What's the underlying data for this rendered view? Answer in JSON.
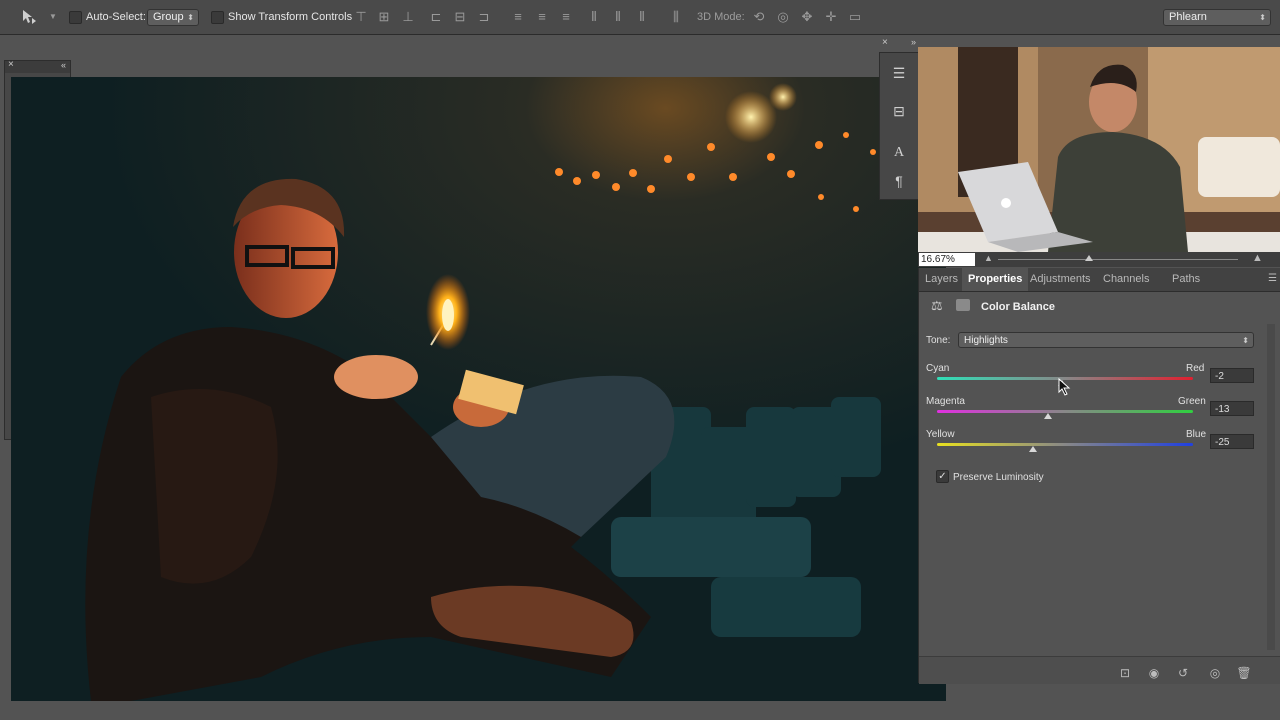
{
  "options_bar": {
    "auto_select_label": "Auto-Select:",
    "auto_select_value": "Group",
    "transform_label": "Show Transform Controls",
    "mode_3d_label": "3D Mode:",
    "workspace_value": "Phlearn"
  },
  "navigator": {
    "zoom": "16.67%"
  },
  "panel": {
    "tabs": [
      {
        "label": "Layers"
      },
      {
        "label": "Properties"
      },
      {
        "label": "Adjustments"
      },
      {
        "label": "Channels"
      },
      {
        "label": "Paths"
      }
    ],
    "title": "Color Balance",
    "tone_label": "Tone:",
    "tone_value": "Highlights",
    "sliders": [
      {
        "left": "Cyan",
        "right": "Red",
        "value": -2
      },
      {
        "left": "Magenta",
        "right": "Green",
        "value": -13
      },
      {
        "left": "Yellow",
        "right": "Blue",
        "value": -25
      }
    ],
    "preserve_label": "Preserve Luminosity",
    "preserve_checked": true
  },
  "colors": {
    "foreground": "#b5521f",
    "background": "#000000"
  }
}
